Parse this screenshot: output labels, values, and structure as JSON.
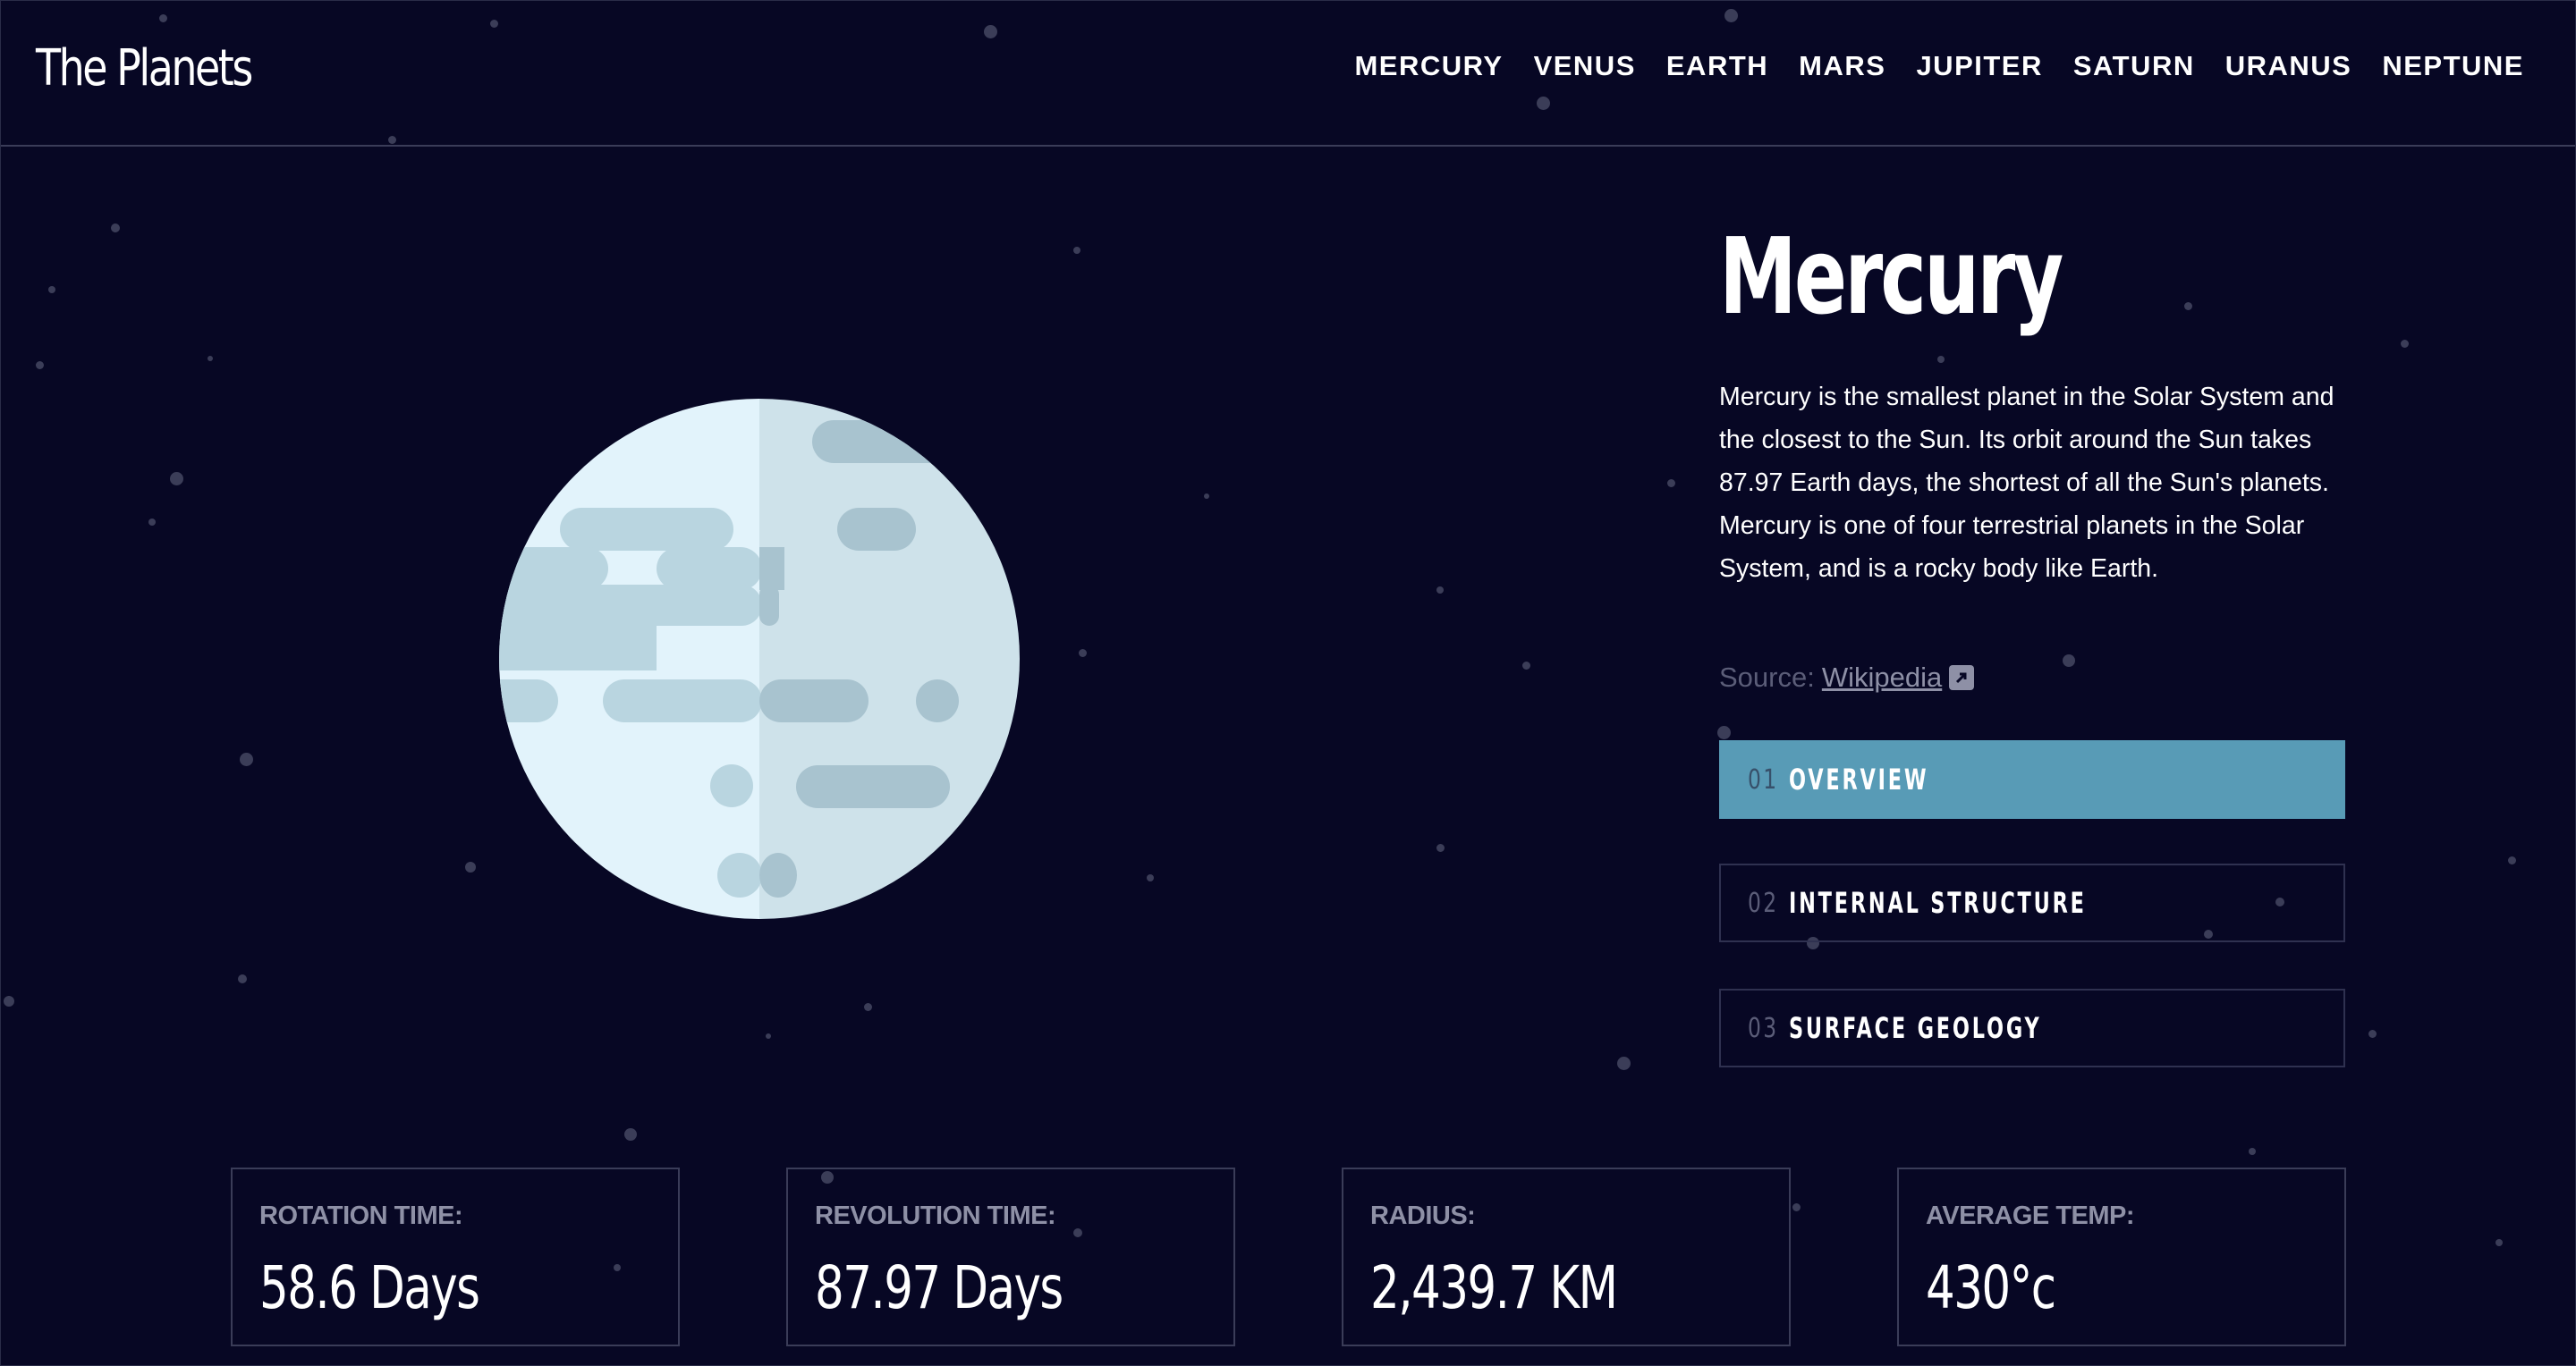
{
  "app": {
    "logo": "The Planets"
  },
  "nav": {
    "items": [
      "MERCURY",
      "VENUS",
      "EARTH",
      "MARS",
      "JUPITER",
      "SATURN",
      "URANUS",
      "NEPTUNE"
    ]
  },
  "planet": {
    "name": "Mercury",
    "description": "Mercury is the smallest planet in the Solar System and the closest to the Sun. Its orbit around the Sun takes 87.97 Earth days, the shortest of all the Sun's planets. Mercury is one of four terrestrial planets in the Solar System, and is a rocky body like Earth.",
    "source_label": "Source:",
    "source_link": "Wikipedia",
    "icon": "planet-mercury-illustration"
  },
  "tabs": [
    {
      "num": "01",
      "label": "OVERVIEW",
      "active": true
    },
    {
      "num": "02",
      "label": "INTERNAL STRUCTURE",
      "active": false
    },
    {
      "num": "03",
      "label": "SURFACE GEOLOGY",
      "active": false
    }
  ],
  "stats": [
    {
      "label": "ROTATION TIME:",
      "value": "58.6 Days"
    },
    {
      "label": "REVOLUTION TIME:",
      "value": "87.97 Days"
    },
    {
      "label": "RADIUS:",
      "value": "2,439.7 KM"
    },
    {
      "label": "AVERAGE TEMP:",
      "value": "430°c"
    }
  ],
  "colors": {
    "background": "#070724",
    "accent": "#589bb6",
    "muted": "#8e90a6",
    "border": "#3a3c58"
  }
}
